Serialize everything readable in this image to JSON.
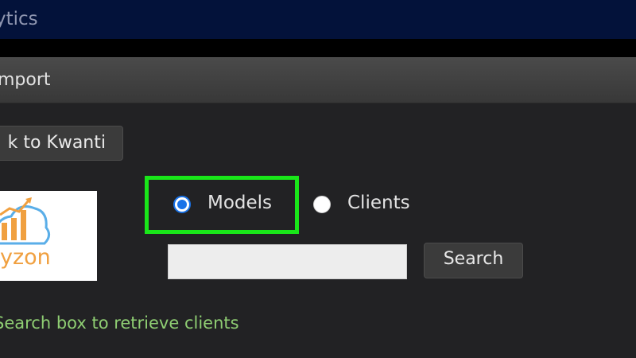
{
  "app": {
    "title": "ytics"
  },
  "dialog": {
    "title": "mport"
  },
  "back_button": {
    "label": "k to Kwanti"
  },
  "logo": {
    "text": "yzon",
    "accent_color": "#f0a040",
    "icon": "cloud-chart-icon"
  },
  "options": {
    "models_label": "Models",
    "clients_label": "Clients",
    "selected": "Models"
  },
  "search": {
    "value": "",
    "placeholder": "",
    "button_label": "Search"
  },
  "help": {
    "text": "Search box to retrieve clients"
  },
  "colors": {
    "highlight": "#19e619",
    "radio_selected": "#1a73e8",
    "help_text": "#8fce73"
  }
}
